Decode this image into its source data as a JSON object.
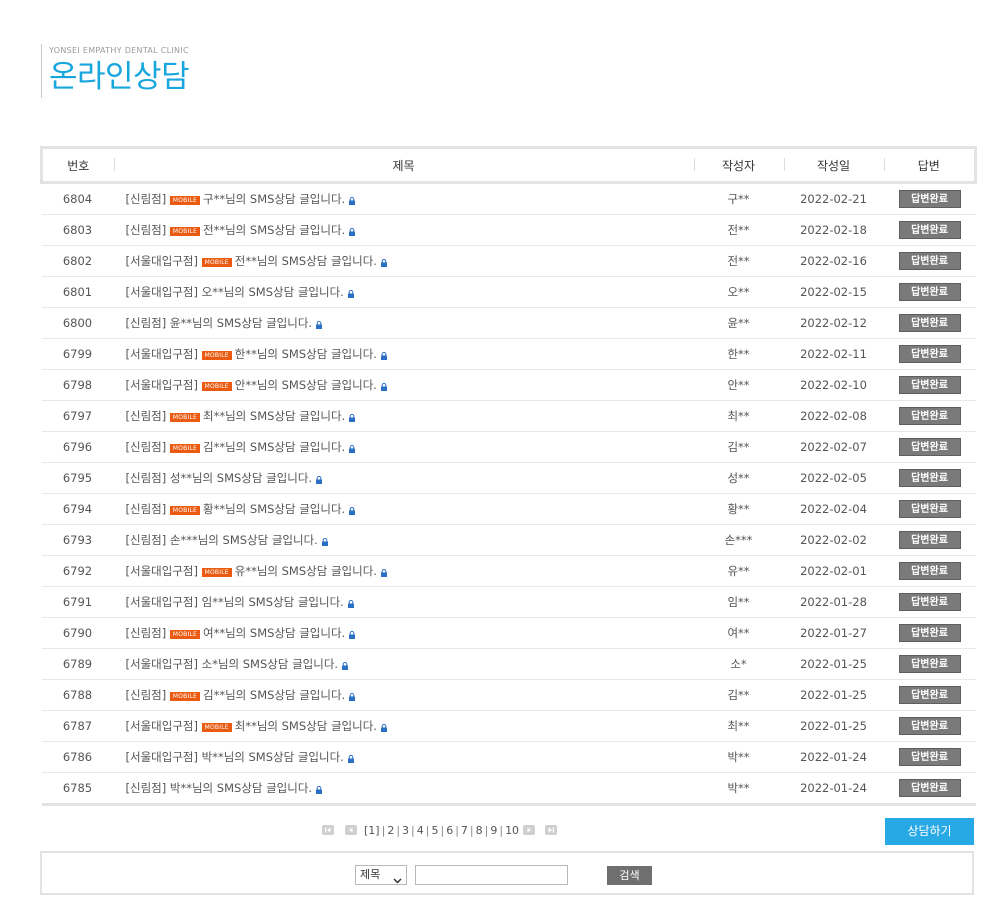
{
  "header": {
    "brand": "YONSEI EMPATHY DENTAL CLINIC",
    "title": "온라인상담"
  },
  "columns": {
    "no": "번호",
    "subject": "제목",
    "author": "작성자",
    "date": "작성일",
    "answer": "답변"
  },
  "mobile_badge": "MOBILE",
  "answer_label": "답변완료",
  "rows": [
    {
      "no": "6804",
      "branch": "[신림점]",
      "mobile": true,
      "text": "구**님의 SMS상담 글입니다.",
      "author": "구**",
      "date": "2022-02-21"
    },
    {
      "no": "6803",
      "branch": "[신림점]",
      "mobile": true,
      "text": "전**님의 SMS상담 글입니다.",
      "author": "전**",
      "date": "2022-02-18"
    },
    {
      "no": "6802",
      "branch": "[서울대입구점]",
      "mobile": true,
      "text": "전**님의 SMS상담 글입니다.",
      "author": "전**",
      "date": "2022-02-16"
    },
    {
      "no": "6801",
      "branch": "[서울대입구점]",
      "mobile": false,
      "text": "오**님의 SMS상담 글입니다.",
      "author": "오**",
      "date": "2022-02-15"
    },
    {
      "no": "6800",
      "branch": "[신림점]",
      "mobile": false,
      "text": "윤**님의 SMS상담 글입니다.",
      "author": "윤**",
      "date": "2022-02-12"
    },
    {
      "no": "6799",
      "branch": "[서울대입구점]",
      "mobile": true,
      "text": "한**님의 SMS상담 글입니다.",
      "author": "한**",
      "date": "2022-02-11"
    },
    {
      "no": "6798",
      "branch": "[서울대입구점]",
      "mobile": true,
      "text": "안**님의 SMS상담 글입니다.",
      "author": "안**",
      "date": "2022-02-10"
    },
    {
      "no": "6797",
      "branch": "[신림점]",
      "mobile": true,
      "text": "최**님의 SMS상담 글입니다.",
      "author": "최**",
      "date": "2022-02-08"
    },
    {
      "no": "6796",
      "branch": "[신림점]",
      "mobile": true,
      "text": "김**님의 SMS상담 글입니다.",
      "author": "김**",
      "date": "2022-02-07"
    },
    {
      "no": "6795",
      "branch": "[신림점]",
      "mobile": false,
      "text": "성**님의 SMS상담 글입니다.",
      "author": "성**",
      "date": "2022-02-05"
    },
    {
      "no": "6794",
      "branch": "[신림점]",
      "mobile": true,
      "text": "황**님의 SMS상담 글입니다.",
      "author": "황**",
      "date": "2022-02-04"
    },
    {
      "no": "6793",
      "branch": "[신림점]",
      "mobile": false,
      "text": "손***님의 SMS상담 글입니다.",
      "author": "손***",
      "date": "2022-02-02"
    },
    {
      "no": "6792",
      "branch": "[서울대입구점]",
      "mobile": true,
      "text": "유**님의 SMS상담 글입니다.",
      "author": "유**",
      "date": "2022-02-01"
    },
    {
      "no": "6791",
      "branch": "[서울대입구점]",
      "mobile": false,
      "text": "임**님의 SMS상담 글입니다.",
      "author": "임**",
      "date": "2022-01-28"
    },
    {
      "no": "6790",
      "branch": "[신림점]",
      "mobile": true,
      "text": "여**님의 SMS상담 글입니다.",
      "author": "여**",
      "date": "2022-01-27"
    },
    {
      "no": "6789",
      "branch": "[서울대입구점]",
      "mobile": false,
      "text": "소*님의 SMS상담 글입니다.",
      "author": "소*",
      "date": "2022-01-25"
    },
    {
      "no": "6788",
      "branch": "[신림점]",
      "mobile": true,
      "text": "김**님의 SMS상담 글입니다.",
      "author": "김**",
      "date": "2022-01-25"
    },
    {
      "no": "6787",
      "branch": "[서울대입구점]",
      "mobile": true,
      "text": "최**님의 SMS상담 글입니다.",
      "author": "최**",
      "date": "2022-01-25"
    },
    {
      "no": "6786",
      "branch": "[서울대입구점]",
      "mobile": false,
      "text": "박**님의 SMS상담 글입니다.",
      "author": "박**",
      "date": "2022-01-24"
    },
    {
      "no": "6785",
      "branch": "[신림점]",
      "mobile": false,
      "text": "박**님의 SMS상담 글입니다.",
      "author": "박**",
      "date": "2022-01-24"
    }
  ],
  "pagination": {
    "current": "[1]",
    "pages": [
      "2",
      "3",
      "4",
      "5",
      "6",
      "7",
      "8",
      "9",
      "10"
    ]
  },
  "consult_button": "상담하기",
  "search": {
    "select_value": "제목",
    "input_value": "",
    "button": "검색"
  },
  "colors": {
    "title": "#17a6dd",
    "mobile_badge": "#ea5b11",
    "answer_button": "#7a7a7a",
    "consult_button": "#27a9e6",
    "lock_icon": "#2a6fc4"
  }
}
